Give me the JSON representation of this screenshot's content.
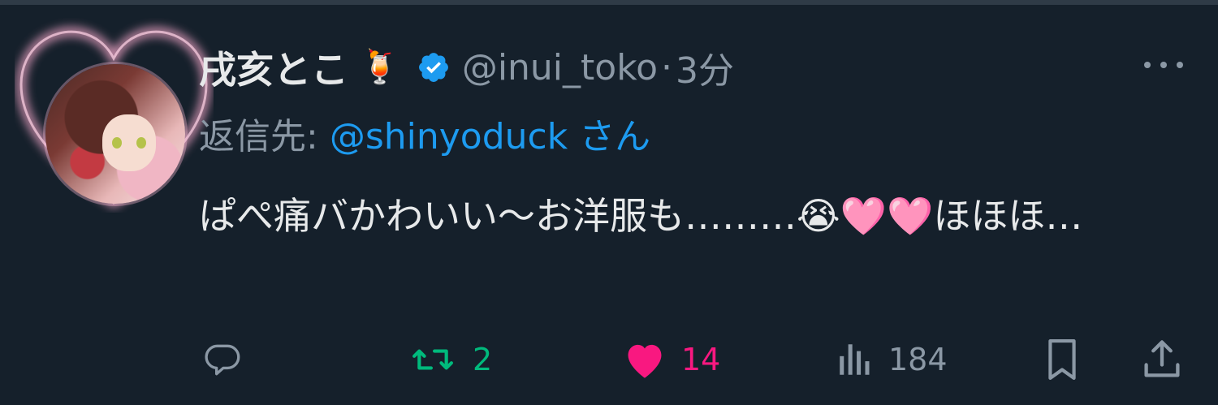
{
  "tweet": {
    "author_name": "戌亥とこ",
    "name_emoji": "🍹",
    "handle": "@inui_toko",
    "separator": "·",
    "time": "3分",
    "reply_prefix": "返信先: ",
    "reply_handle": "@shinyoduck",
    "reply_suffix": "さん",
    "text_part1": "ぱぺ痛バかわいい〜お洋服も………",
    "emoji_crying": "😭",
    "emoji_heart1": "🩷",
    "emoji_heart2": "🩷",
    "text_part2": "ほほほ…"
  },
  "actions": {
    "retweet_count": "2",
    "like_count": "14",
    "views_count": "184"
  },
  "colors": {
    "background": "#15202b",
    "verified": "#1d9bf0",
    "retweet": "#00ba7c",
    "like": "#f91880",
    "muted": "#8b98a5"
  },
  "icons": [
    "verified-icon",
    "more-icon",
    "reply-icon",
    "retweet-icon",
    "heart-icon",
    "views-icon",
    "bookmark-icon",
    "share-icon"
  ]
}
